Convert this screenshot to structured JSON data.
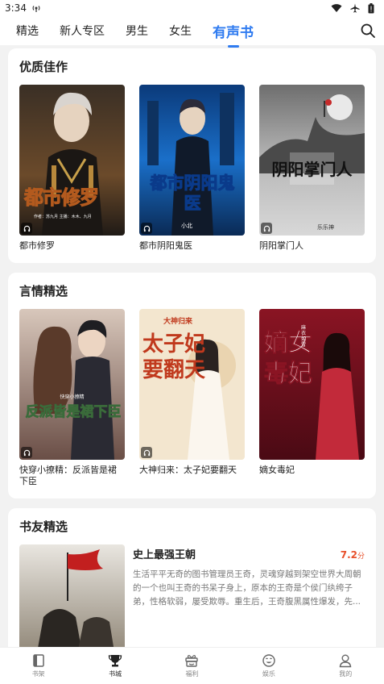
{
  "status_bar": {
    "time": "3:34"
  },
  "top_tabs": [
    {
      "label": "精选"
    },
    {
      "label": "新人专区"
    },
    {
      "label": "男生"
    },
    {
      "label": "女生"
    },
    {
      "label": "有声书",
      "active": true
    }
  ],
  "sections": [
    {
      "title": "优质佳作",
      "books": [
        {
          "name": "都市修罗",
          "cover_text": "都市修罗",
          "cover_sub": "作者：苏九月  主播：木木、九月"
        },
        {
          "name": "都市阴阳鬼医",
          "cover_text": "都市阴阳鬼医",
          "cover_sub": "小北"
        },
        {
          "name": "阴阳掌门人",
          "cover_text": "阴阳掌门人",
          "cover_sub": "乐乐神"
        }
      ]
    },
    {
      "title": "言情精选",
      "books": [
        {
          "name": "快穿小撩精：反派皆是裙下臣",
          "cover_text": "反派皆是裙下臣",
          "cover_sub": "快穿小撩精"
        },
        {
          "name": "大神归来：太子妃要翻天",
          "cover_text": "太子妃要翻天",
          "cover_sub": "大神归来"
        },
        {
          "name": "嫡女毒妃",
          "cover_text": "嫡女毒妃",
          "cover_sub": "麻衣如雪"
        }
      ]
    }
  ],
  "featured": {
    "section_title": "书友精选",
    "title": "史上最强王朝",
    "score": "7.2",
    "score_unit": "分",
    "description": "生活平平无奇的图书管理员王奇，灵魂穿越到架空世界大周朝的一个也叫王奇的书呆子身上，原本的王奇是个侯门纨绔子弟，性格软弱，屡受欺辱。重生后，王奇腹黑属性爆发，先..."
  },
  "bottom_nav": [
    {
      "label": "书架",
      "icon": "bookshelf-icon"
    },
    {
      "label": "书城",
      "icon": "trophy-icon",
      "active": true
    },
    {
      "label": "福利",
      "icon": "gift-icon"
    },
    {
      "label": "娱乐",
      "icon": "smile-icon"
    },
    {
      "label": "我的",
      "icon": "user-icon"
    }
  ],
  "colors": {
    "accent": "#2f7bf0",
    "score": "#e8502b"
  }
}
